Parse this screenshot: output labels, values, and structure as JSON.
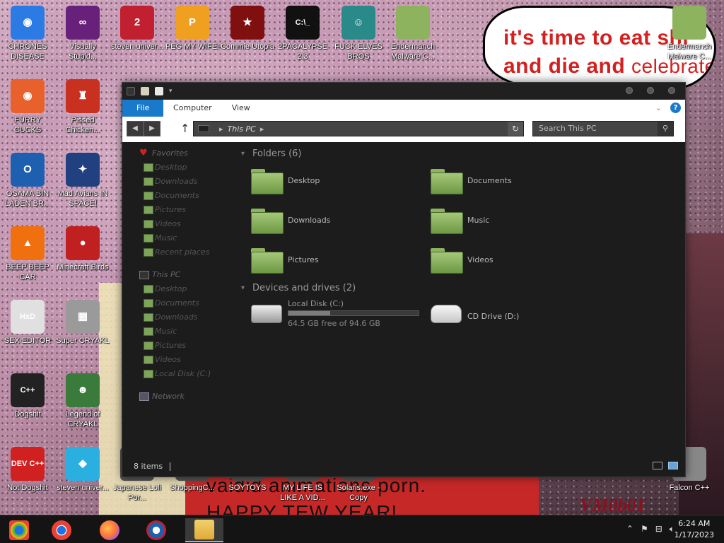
{
  "desktop": {
    "speech_bubble": {
      "line1": "it's time to eat shi",
      "line2_a": "and die and ",
      "line2_b": "celebrate"
    },
    "banner": {
      "line1": "vaidid animations porn.",
      "line2": "HAPPY TEW YEAR!"
    },
    "tag": "VM0b01",
    "icons": [
      {
        "label": "CHRONES DISEASE",
        "glyph": "◉",
        "color": "#2c7be5"
      },
      {
        "label": "Visually Stupid...",
        "glyph": "∞",
        "color": "#68217a"
      },
      {
        "label": "steven univer...",
        "glyph": "2",
        "color": "#c02030"
      },
      {
        "label": "PEG MY WIFE!",
        "glyph": "P",
        "color": "#f0a020"
      },
      {
        "label": "Commie Utopia",
        "glyph": "★",
        "color": "#801010"
      },
      {
        "label": "2PACALYPSE 2.3",
        "glyph": "C:\\_",
        "color": "#111111"
      },
      {
        "label": "FUCK ELVES BROS",
        "glyph": "☺",
        "color": "#2a8a8a"
      },
      {
        "label": "Endermanch Malware C...",
        "glyph": "",
        "color": "#8db35e"
      },
      {
        "label": "Endermanch Malware C...",
        "glyph": "",
        "color": "#8db35e"
      },
      {
        "label": "FURRY CUCKS",
        "glyph": "◉",
        "color": "#e8602c"
      },
      {
        "label": "Pissed Chicken...",
        "glyph": "♜",
        "color": "#c83020"
      },
      {
        "label": "OSAMA BIN LADEN BR...",
        "glyph": "O",
        "color": "#1f5fb0"
      },
      {
        "label": "Mad Avians IN SPACE!",
        "glyph": "✦",
        "color": "#204080"
      },
      {
        "label": "BEEP BEEP CAR",
        "glyph": "▲",
        "color": "#f07010"
      },
      {
        "label": "Minecraft Birds",
        "glyph": "●",
        "color": "#c02020"
      },
      {
        "label": "SEX EDITOR",
        "glyph": "HxD",
        "color": "#e0e0e0"
      },
      {
        "label": "Super CRYAKL",
        "glyph": "▦",
        "color": "#9a9a9a"
      },
      {
        "label": "Dogshit",
        "glyph": "C++",
        "color": "#222222"
      },
      {
        "label": "Legend of CRYAKL",
        "glyph": "☻",
        "color": "#3a7a3a"
      },
      {
        "label": "Not Dogshit",
        "glyph": "DEV C++",
        "color": "#d02020"
      },
      {
        "label": "steven univer...",
        "glyph": "◆",
        "color": "#2ab0e0"
      },
      {
        "label": "Japanese Loli Por...",
        "glyph": "",
        "color": "#555555"
      },
      {
        "label": "ShoppingC...",
        "glyph": "",
        "color": "#555555"
      },
      {
        "label": "SOYTOYS",
        "glyph": "",
        "color": "#555555"
      },
      {
        "label": "MY LIFE IS LIKE A VID...",
        "glyph": "",
        "color": "#555555"
      },
      {
        "label": "Solaris.exe - Copy",
        "glyph": "",
        "color": "#555555"
      },
      {
        "label": "Falcon C++",
        "glyph": "",
        "color": "#888888"
      }
    ]
  },
  "explorer": {
    "ribbon": {
      "tabs": [
        "File",
        "Computer",
        "View"
      ],
      "help": "?"
    },
    "address": {
      "location": "This PC",
      "search_placeholder": "Search This PC"
    },
    "nav": {
      "favorites_head": "Favorites",
      "favorites": [
        "Desktop",
        "Downloads",
        "Documents",
        "Pictures",
        "Videos",
        "Music",
        "Recent places"
      ],
      "thispc_head": "This PC",
      "thispc": [
        "Desktop",
        "Documents",
        "Downloads",
        "Music",
        "Pictures",
        "Videos",
        "Local Disk (C:)"
      ],
      "network": "Network"
    },
    "groups": {
      "folders_head": "Folders (6)",
      "folders": [
        "Desktop",
        "Documents",
        "Downloads",
        "Music",
        "Pictures",
        "Videos"
      ],
      "drives_head": "Devices and drives (2)",
      "local_disk": {
        "name": "Local Disk (C:)",
        "free_text": "64.5 GB free of 94.6 GB",
        "used_fraction": 0.318
      },
      "cd_drive": {
        "name": "CD Drive (D:)"
      }
    },
    "status": {
      "items": "8 items"
    }
  },
  "taskbar": {
    "clock_time": "6:24 AM",
    "clock_date": "1/17/2023",
    "apps": [
      "chrome-alt",
      "chrome",
      "firefox",
      "obama",
      "file-explorer"
    ]
  }
}
